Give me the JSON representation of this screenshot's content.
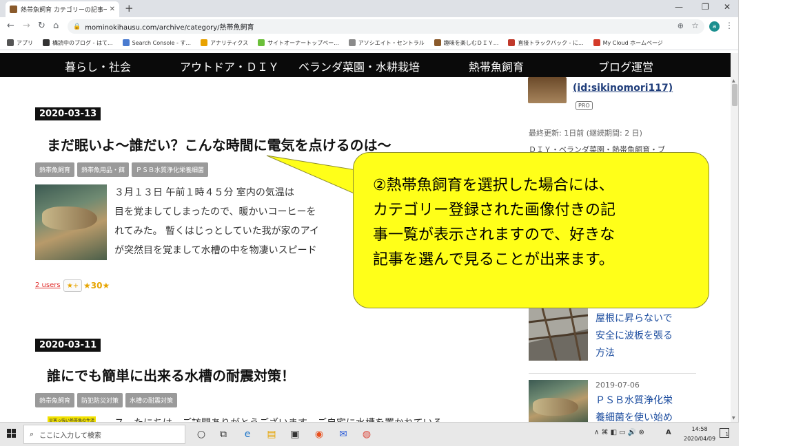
{
  "browser": {
    "tab_title": "熱帯魚飼育 カテゴリーの記事一覧 ...",
    "tab_close": "✕",
    "new_tab": "+",
    "url": "mominokihausu.com/archive/category/熱帯魚飼育",
    "avatar_letter": "a",
    "window_controls": {
      "minimize": "—",
      "maximize": "❐",
      "close": "✕"
    }
  },
  "bookmarks": [
    {
      "label": "アプリ",
      "color": "#555555"
    },
    {
      "label": "構読中のブログ - はて...",
      "color": "#333333"
    },
    {
      "label": "Search Console - す...",
      "color": "#4a7bd0"
    },
    {
      "label": "アナリティクス",
      "color": "#e8a200"
    },
    {
      "label": "サイトオーナートップペー...",
      "color": "#6bbf3a"
    },
    {
      "label": "アソシエイト・セントラル",
      "color": "#8a8a8a"
    },
    {
      "label": "趣味を楽しむＤＩＹ...",
      "color": "#8a5a2b"
    },
    {
      "label": "直接トラックバック - に...",
      "color": "#c0392b"
    },
    {
      "label": "My Cloud ホームページ",
      "color": "#d43b2a"
    }
  ],
  "nav": {
    "items": [
      "暮らし・社会",
      "アウトドア・ＤＩＹ",
      "ベランダ菜園・水耕栽培",
      "熱帯魚飼育",
      "ブログ運営"
    ]
  },
  "posts": [
    {
      "date": "2020-03-13",
      "title": "まだ眠いよ～誰だい？こんな時間に電気を点けるのは～",
      "tags": [
        "熱帯魚飼育",
        "熱帯魚用品・餌",
        "ＰＳＢ水質浄化栄養細菌"
      ],
      "excerpt_lines": [
        "３月１３日 午前１時４５分 室内の気温は",
        "目を覚ましてしまったので、暖かいコーヒーを",
        "れてみた。 暫くはじっとしていた我が家のアイ",
        "が突然目を覚まして水槽の中を物凄いスピード"
      ],
      "users": "2 users",
      "star_button": "★+",
      "star_count": "★30★"
    },
    {
      "date": "2020-03-11",
      "title": "誰にでも簡単に出来る水槽の耐震対策！",
      "tags": [
        "熱帯魚飼育",
        "防犯防災対策",
        "水槽の耐震対策"
      ],
      "badge": "災害っ強い熱帯魚の生活",
      "excerpt_partial": "ス　たにちは。ご訪問ありがとうございます　ご自宅に水槽を置かれている"
    }
  ],
  "sidebar": {
    "user_id": "(id:sikinomori117)",
    "pro": "PRO",
    "last_updated": "最終更新: 1日前 (継続期間: 2 日)",
    "categories_partial": "ＤＩＹ・ベランダ菜園・熱帯魚飼育・ブ",
    "entries": [
      {
        "lines": [
          "屋根に昇らないで",
          "安全に波板を張る",
          "方法"
        ]
      },
      {
        "date": "2019-07-06",
        "lines": [
          "ＰＳＢ水質浄化栄",
          "養細菌を使い始め"
        ]
      }
    ]
  },
  "callout": {
    "lines": [
      "②熱帯魚飼育を選択した場合には、",
      "カテゴリー登録された画像付きの記",
      "事一覧が表示されますので、好きな",
      "記事を選んで見ることが出来ます。"
    ],
    "color": "#ffff19"
  },
  "taskbar": {
    "search_placeholder": "ここに入力して検索",
    "time": "14:58",
    "date": "2020/04/09",
    "ime": "A",
    "notification_count": "1"
  }
}
